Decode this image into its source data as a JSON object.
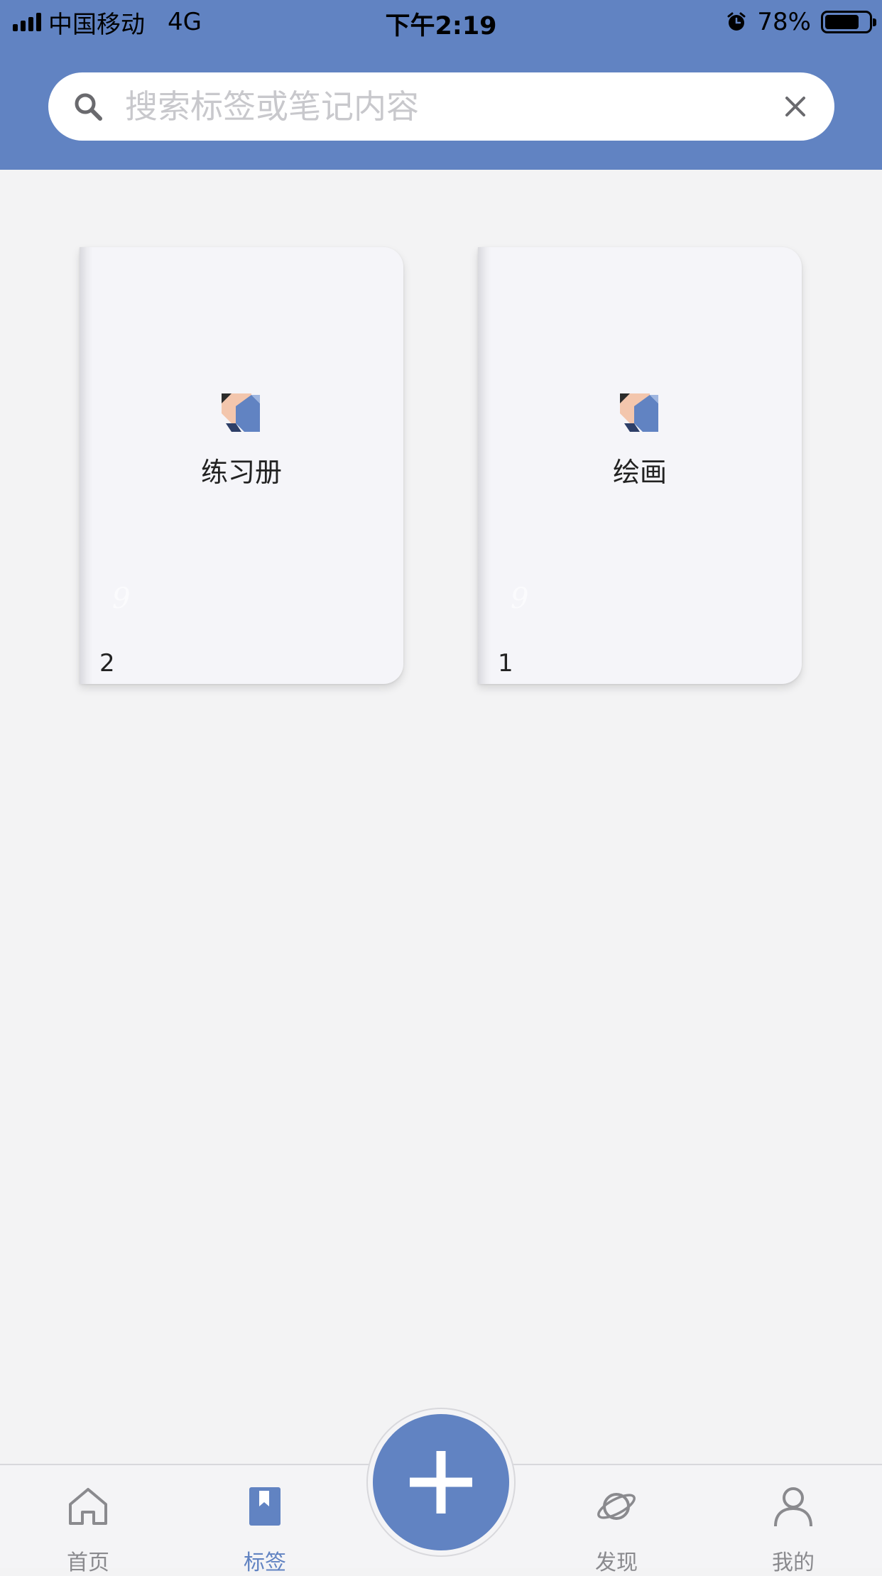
{
  "status_bar": {
    "carrier": "中国移动",
    "network": "4G",
    "time": "下午2:19",
    "battery": "78%",
    "battery_level": 0.78
  },
  "search": {
    "placeholder": "搜索标签或笔记内容"
  },
  "tags": [
    {
      "title": "练习册",
      "count": "2",
      "faint_mark": "9"
    },
    {
      "title": "绘画",
      "count": "1",
      "faint_mark": "9"
    }
  ],
  "tab_bar": {
    "items": [
      {
        "label": "首页",
        "icon": "home-icon",
        "active": false
      },
      {
        "label": "标签",
        "icon": "bookmark-icon",
        "active": true
      },
      {
        "label": "发现",
        "icon": "planet-icon",
        "active": false
      },
      {
        "label": "我的",
        "icon": "person-icon",
        "active": false
      }
    ],
    "fab_icon": "plus-icon"
  },
  "colors": {
    "brand": "#6183c2",
    "background": "#f3f3f4",
    "inactive_tab": "#8a8a8e"
  }
}
